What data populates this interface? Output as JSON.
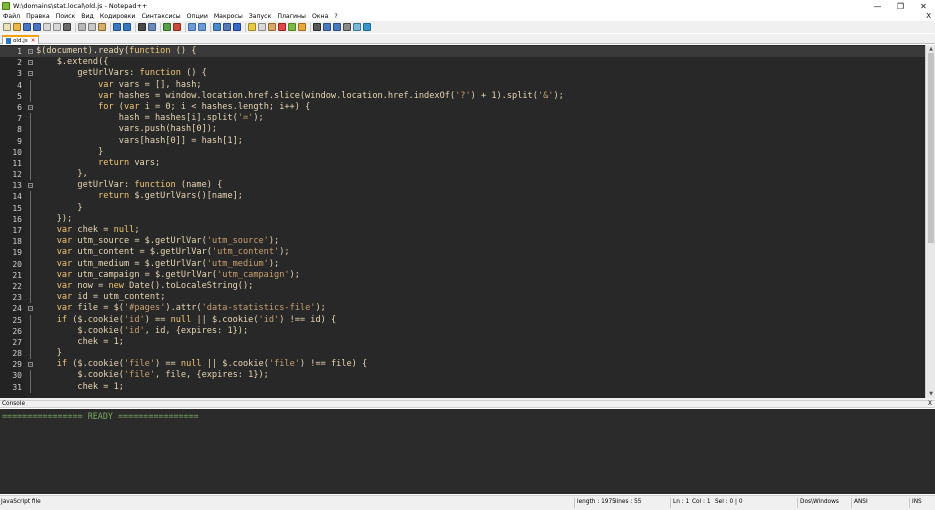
{
  "window": {
    "title": "W:\\domains\\stat.local\\old.js - Notepad++"
  },
  "menu": [
    "Файл",
    "Правка",
    "Поиск",
    "Вид",
    "Кодировки",
    "Синтаксисы",
    "Опции",
    "Макросы",
    "Запуск",
    "Плагины",
    "Окна",
    "?"
  ],
  "menu_close": "X",
  "tab": {
    "label": "old.js"
  },
  "editor": {
    "lines": [
      "$(document).ready(function () {",
      "    $.extend({",
      "        getUrlVars: function () {",
      "            var vars = [], hash;",
      "            var hashes = window.location.href.slice(window.location.href.indexOf('?') + 1).split('&');",
      "            for (var i = 0; i < hashes.length; i++) {",
      "                hash = hashes[i].split('=');",
      "                vars.push(hash[0]);",
      "                vars[hash[0]] = hash[1];",
      "            }",
      "            return vars;",
      "        },",
      "        getUrlVar: function (name) {",
      "            return $.getUrlVars()[name];",
      "        }",
      "    });",
      "    var chek = null;",
      "    var utm_source = $.getUrlVar('utm_source');",
      "    var utm_content = $.getUrlVar('utm_content');",
      "    var utm_medium = $.getUrlVar('utm_medium');",
      "    var utm_campaign = $.getUrlVar('utm_campaign');",
      "    var now = new Date().toLocaleString();",
      "    var id = utm_content;",
      "    var file = $('#pages').attr('data-statistics-file');",
      "    if ($.cookie('id') == null || $.cookie('id') !== id) {",
      "        $.cookie('id', id, {expires: 1});",
      "        chek = 1;",
      "    }",
      "    if ($.cookie('file') == null || $.cookie('file') !== file) {",
      "        $.cookie('file', file, {expires: 1});",
      "        chek = 1;"
    ],
    "fold_lines": [
      1,
      2,
      3,
      6,
      13,
      24,
      29
    ]
  },
  "console": {
    "header": "Console",
    "close": "X",
    "text": "================ READY ================"
  },
  "status": {
    "filetype": "JavaScript file",
    "length": "length : 1975",
    "lines": "lines : 55",
    "ln": "Ln : 1",
    "col": "Col : 1",
    "sel": "Sel : 0 | 0",
    "eol": "Dos\\Windows",
    "encoding": "ANSI",
    "mode": "INS"
  },
  "window_controls": {
    "minimize": "—",
    "maximize": "❐",
    "close": "✕"
  },
  "colors": {
    "editor_bg": "#282828",
    "console_bg": "#2b2b2b",
    "console_text": "#79a860",
    "code_text": "#e6d8b6",
    "tab_accent": "#f4a10f"
  }
}
